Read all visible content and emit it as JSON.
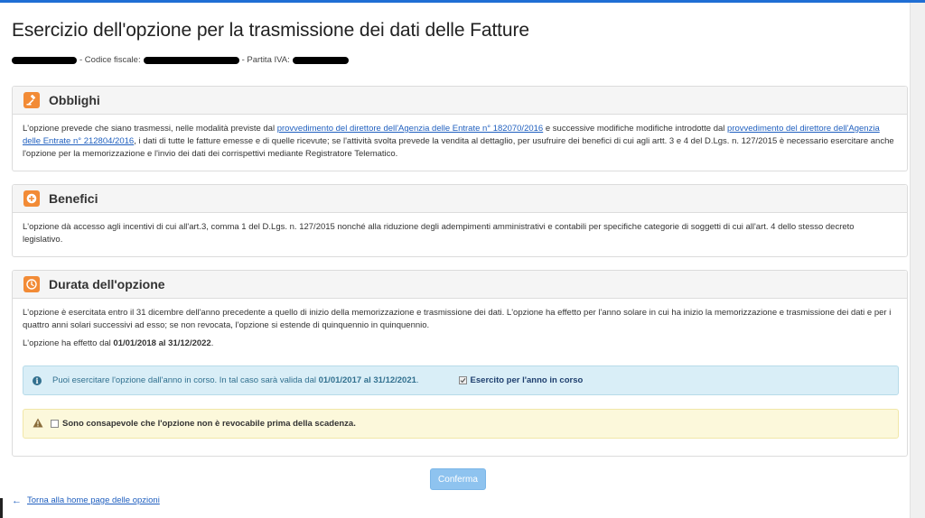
{
  "page": {
    "title": "Esercizio dell'opzione per la trasmissione dei dati delle Fatture",
    "codice_fiscale_label": "- Codice fiscale:",
    "partita_iva_label": "- Partita IVA:"
  },
  "obblighi": {
    "title": "Obblighi",
    "text1": "L'opzione prevede che siano trasmessi, nelle modalità previste dal ",
    "link1": "provvedimento del direttore dell'Agenzia delle Entrate n° 182070/2016",
    "text2": " e successive modifiche modifiche introdotte dal ",
    "link2": "provvedimento del direttore dell'Agenzia delle Entrate n° 212804/2016",
    "text3": ", i dati di tutte le fatture emesse e di quelle ricevute; se l'attività svolta prevede la vendita al dettaglio, per usufruire dei benefici di cui agli artt. 3 e 4 del D.Lgs. n. 127/2015 è necessario esercitare anche l'opzione per la memorizzazione e l'invio dei dati dei corrispettivi mediante Registratore Telematico."
  },
  "benefici": {
    "title": "Benefici",
    "text": "L'opzione dà accesso agli incentivi di cui all'art.3, comma 1 del D.Lgs. n. 127/2015 nonché alla riduzione degli adempimenti amministrativi e contabili per specifiche categorie di soggetti di cui all'art. 4 dello stesso decreto legislativo."
  },
  "durata": {
    "title": "Durata dell'opzione",
    "text": "L'opzione è esercitata entro il 31 dicembre dell'anno precedente a quello di inizio della memorizzazione e trasmissione dei dati. L'opzione ha effetto per l'anno solare in cui ha inizio la memorizzazione e trasmissione dei dati e per i quattro anni solari successivi ad esso; se non revocata, l'opzione si estende di quinquennio in quinquennio.",
    "effect_prefix": "L'opzione ha effetto dal ",
    "effect_range": "01/01/2018 al 31/12/2022",
    "effect_suffix": ".",
    "info_prefix": "Puoi esercitare l'opzione dall'anno in corso. In tal caso sarà valida dal ",
    "info_range": "01/01/2017 al 31/12/2021",
    "info_suffix": ".",
    "current_year_label": "Esercito per l'anno in corso",
    "current_year_checked": true,
    "ack_label": "Sono consapevole che l'opzione non è revocabile prima della scadenza.",
    "ack_checked": false
  },
  "actions": {
    "confirm_label": "Conferma",
    "back_label": "Torna alla home page delle opzioni"
  },
  "icons": {
    "obblighi": "gavel-icon",
    "benefici": "plus-circle-icon",
    "durata": "clock-icon",
    "info": "info-icon",
    "warning": "warning-icon",
    "back": "arrow-left-icon"
  },
  "colors": {
    "accent": "#f28b36",
    "link": "#1f5fbf",
    "info_bg": "#d9eef7",
    "warn_bg": "#fcf8db",
    "button": "#8ec3ef"
  }
}
